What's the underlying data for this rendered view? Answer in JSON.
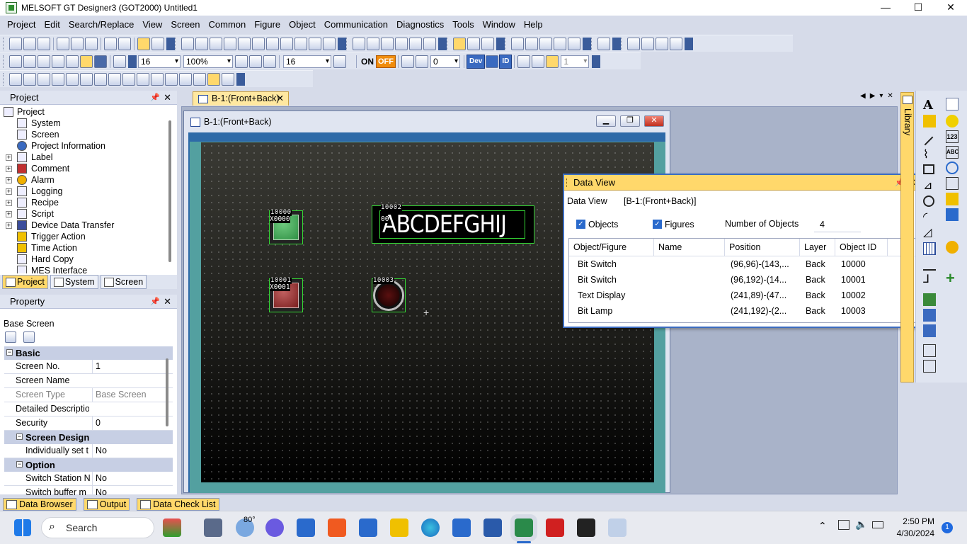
{
  "window": {
    "title": "MELSOFT GT Designer3 (GOT2000) Untitled1",
    "minimize": "—",
    "maximize": "☐",
    "close": "✕"
  },
  "menu": [
    "Project",
    "Edit",
    "Search/Replace",
    "View",
    "Screen",
    "Common",
    "Figure",
    "Object",
    "Communication",
    "Diagnostics",
    "Tools",
    "Window",
    "Help"
  ],
  "toolbar2": {
    "font_size": "16",
    "zoom": "100%",
    "grid": "16",
    "step": "0",
    "on_label": "ON",
    "off_label": "OFF",
    "dev": "Dev",
    "id": "ID",
    "layer": "1"
  },
  "project_panel": {
    "title": "Project",
    "tree": [
      "Project",
      "System",
      "Screen",
      "Project Information",
      "Label",
      "Comment",
      "Alarm",
      "Logging",
      "Recipe",
      "Script",
      "Device Data Transfer",
      "Trigger Action",
      "Time Action",
      "Hard Copy",
      "MES Interface"
    ],
    "tabs": [
      "Project",
      "System",
      "Screen"
    ]
  },
  "property_panel": {
    "title": "Property",
    "object": "Base Screen",
    "cat_basic": "Basic",
    "rows_basic": [
      {
        "k": "Screen No.",
        "v": "1"
      },
      {
        "k": "Screen Name",
        "v": ""
      },
      {
        "k": "Screen Type",
        "v": "Base Screen"
      },
      {
        "k": "Detailed Descriptio",
        "v": ""
      },
      {
        "k": "Security",
        "v": "0"
      }
    ],
    "cat_design": "Screen Design",
    "row_design": {
      "k": "Individually set t",
      "v": "No"
    },
    "cat_option": "Option",
    "rows_option": [
      {
        "k": "Switch Station N",
        "v": "No"
      },
      {
        "k": "Switch buffer m",
        "v": "No"
      }
    ]
  },
  "bottom_tabs": [
    "Data Browser",
    "Output",
    "Data Check List"
  ],
  "document": {
    "tab_label": "B-1:(Front+Back)",
    "tab_close": "✕",
    "window_title": "B-1:(Front+Back)",
    "objects": [
      {
        "id": "10000",
        "device": "X0000"
      },
      {
        "id": "10001",
        "device": "X0001"
      },
      {
        "id": "10002",
        "device": "00",
        "text": "ABCDEFGHIJ"
      },
      {
        "id": "10003"
      }
    ]
  },
  "data_view": {
    "title": "Data View",
    "label": "Data View",
    "screen": "[B-1:(Front+Back)]",
    "objects_label": "Objects",
    "figures_label": "Figures",
    "count_label": "Number of Objects",
    "count": "4",
    "headers": [
      "Object/Figure",
      "Name",
      "Position",
      "Layer",
      "Object ID"
    ],
    "rows": [
      {
        "type": "Bit Switch",
        "name": "",
        "pos": "(96,96)-(143,...",
        "layer": "Back",
        "id": "10000"
      },
      {
        "type": "Bit Switch",
        "name": "",
        "pos": "(96,192)-(14...",
        "layer": "Back",
        "id": "10001"
      },
      {
        "type": "Text Display",
        "name": "",
        "pos": "(241,89)-(47...",
        "layer": "Back",
        "id": "10002"
      },
      {
        "type": "Bit Lamp",
        "name": "",
        "pos": "(241,192)-(2...",
        "layer": "Back",
        "id": "10003"
      }
    ]
  },
  "library_label": "Library",
  "taskbar": {
    "search": "Search",
    "weather": "80°",
    "time": "2:50 PM",
    "date": "4/30/2024",
    "notif": "1"
  }
}
